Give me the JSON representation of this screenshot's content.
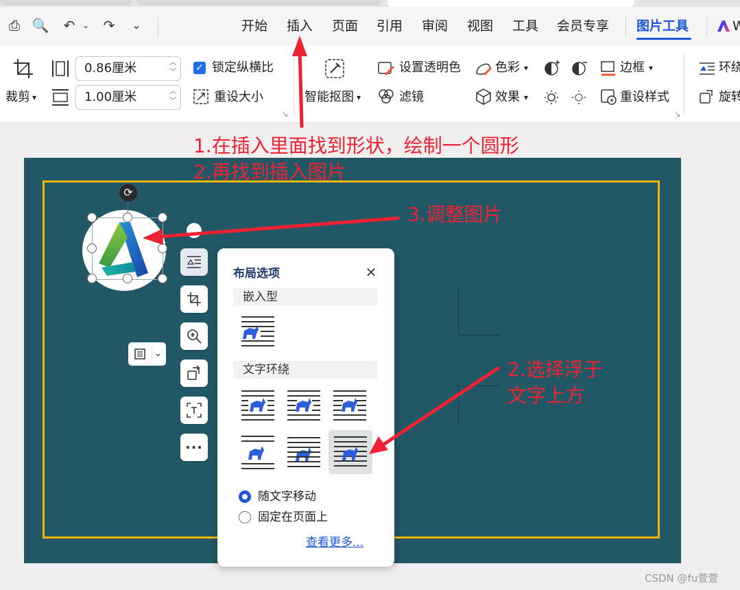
{
  "menu": {
    "items": [
      "开始",
      "插入",
      "页面",
      "引用",
      "审阅",
      "视图",
      "工具",
      "会员专享"
    ],
    "active": "图片工具",
    "brand_partial": "W"
  },
  "ribbon": {
    "crop_label": "裁剪",
    "width_value": "0.86厘米",
    "height_value": "1.00厘米",
    "lock_ratio_label": "锁定纵横比",
    "lock_ratio_checked": true,
    "reset_size_label": "重设大小",
    "smart_cutout_label": "智能抠图",
    "transparent_label": "设置透明色",
    "filter_label": "滤镜",
    "color_label": "色彩",
    "effect_label": "效果",
    "border_label": "边框",
    "reset_style_label": "重设样式",
    "wrap_label": "环绕",
    "rotate_label": "旋转"
  },
  "popup": {
    "title": "布局选项",
    "section_inline": "嵌入型",
    "section_wrap": "文字环绕",
    "radio_move": "随文字移动",
    "radio_fixed": "固定在页面上",
    "radio_selected": "随文字移动",
    "more_link": "查看更多..."
  },
  "annotations": {
    "step1": "1.在插入里面找到形状，绘制一个圆形",
    "step2": "2.再找到插入图片",
    "step3": "3.调整图片",
    "step4_line1": "2.选择浮于",
    "step4_line2": "文字上方",
    "color": "#ee2233"
  },
  "watermark": "CSDN @fu萱萱",
  "colors": {
    "accent": "#1f57d6",
    "slide_bg": "#225866",
    "slide_border": "#f2b705"
  }
}
